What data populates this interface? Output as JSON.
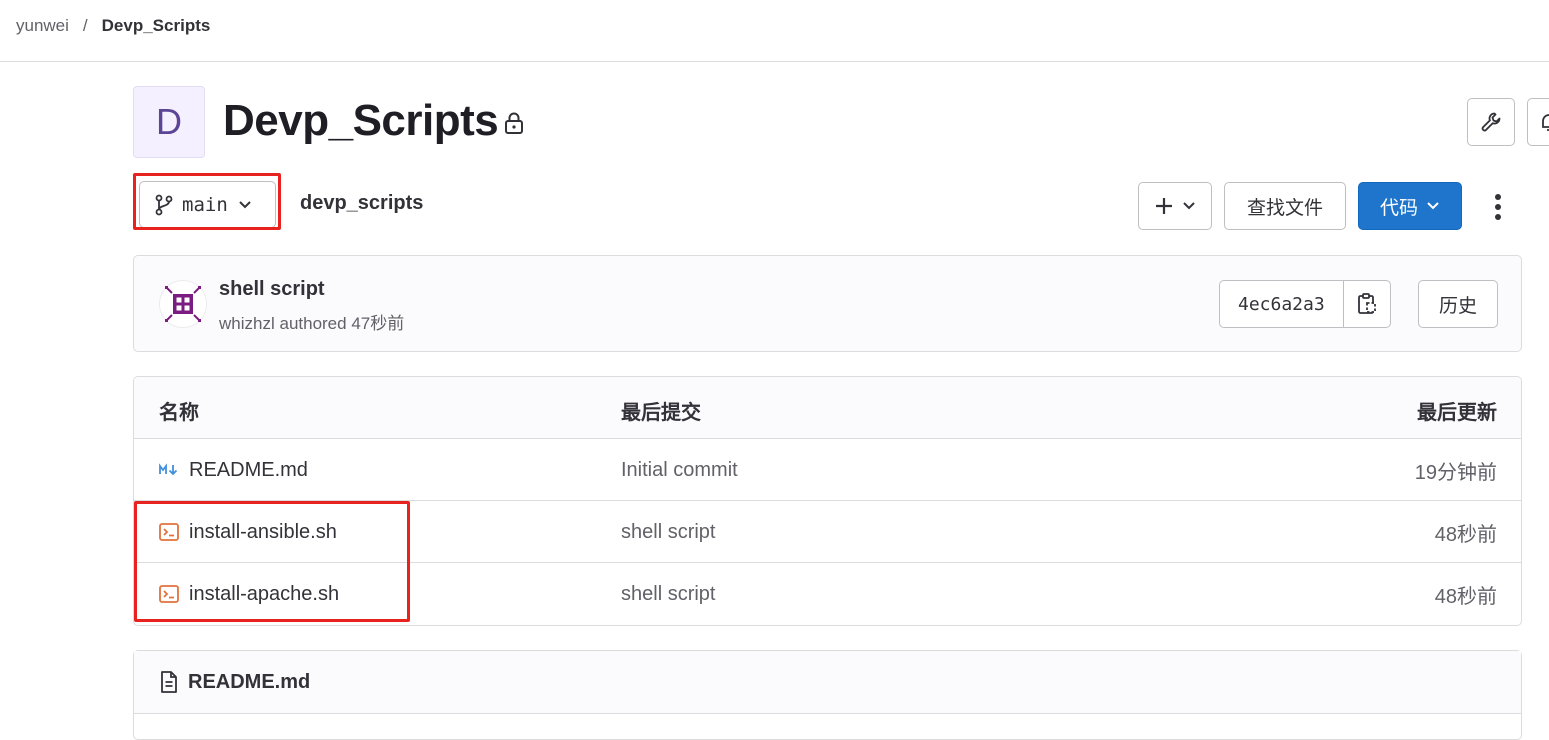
{
  "breadcrumb": {
    "group": "yunwei",
    "separator": "/",
    "project": "Devp_Scripts"
  },
  "project": {
    "avatar_letter": "D",
    "title": "Devp_Scripts"
  },
  "toolbar": {
    "branch": "main",
    "path": "devp_scripts",
    "find_file": "查找文件",
    "code": "代码"
  },
  "last_commit": {
    "title": "shell script",
    "author": "whizhzl",
    "authored_text": "authored",
    "time": "47秒前",
    "sha": "4ec6a2a3",
    "history": "历史"
  },
  "file_table": {
    "headers": {
      "name": "名称",
      "last_commit": "最后提交",
      "last_update": "最后更新"
    },
    "rows": [
      {
        "name": "README.md",
        "icon": "markdown-icon",
        "commit": "Initial commit",
        "updated": "19分钟前"
      },
      {
        "name": "install-ansible.sh",
        "icon": "terminal-file-icon",
        "commit": "shell script",
        "updated": "48秒前"
      },
      {
        "name": "install-apache.sh",
        "icon": "terminal-file-icon",
        "commit": "shell script",
        "updated": "48秒前"
      }
    ]
  },
  "readme": {
    "title": "README.md"
  },
  "colors": {
    "primary": "#1f75cb",
    "highlight_box": "#e8231f",
    "shell_icon": "#e2723c",
    "markdown_icon": "#428fdc"
  }
}
